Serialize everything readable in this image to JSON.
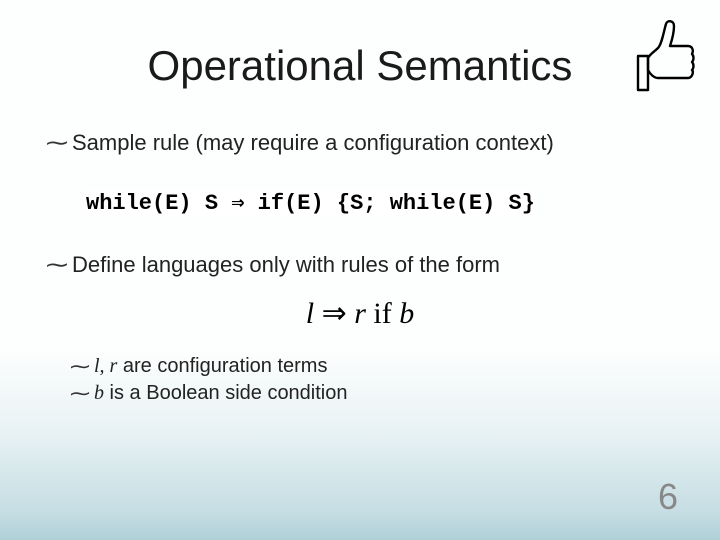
{
  "title": "Operational Semantics",
  "bullets": {
    "b1": "Sample rule (may require a configuration context)",
    "b2": "Define languages only with rules of the form",
    "b3_prefix": "l, r",
    "b3_rest": " are configuration terms",
    "b4_prefix": "b",
    "b4_rest": " is a Boolean side condition"
  },
  "rule": "while(E) S  ⇒  if(E) {S; while(E) S}",
  "formula": {
    "l": "l",
    "arrow": " ⇒ ",
    "r": "r",
    "if": " if ",
    "b": "b"
  },
  "page_number": "6",
  "bullet_glyph": "⁓"
}
